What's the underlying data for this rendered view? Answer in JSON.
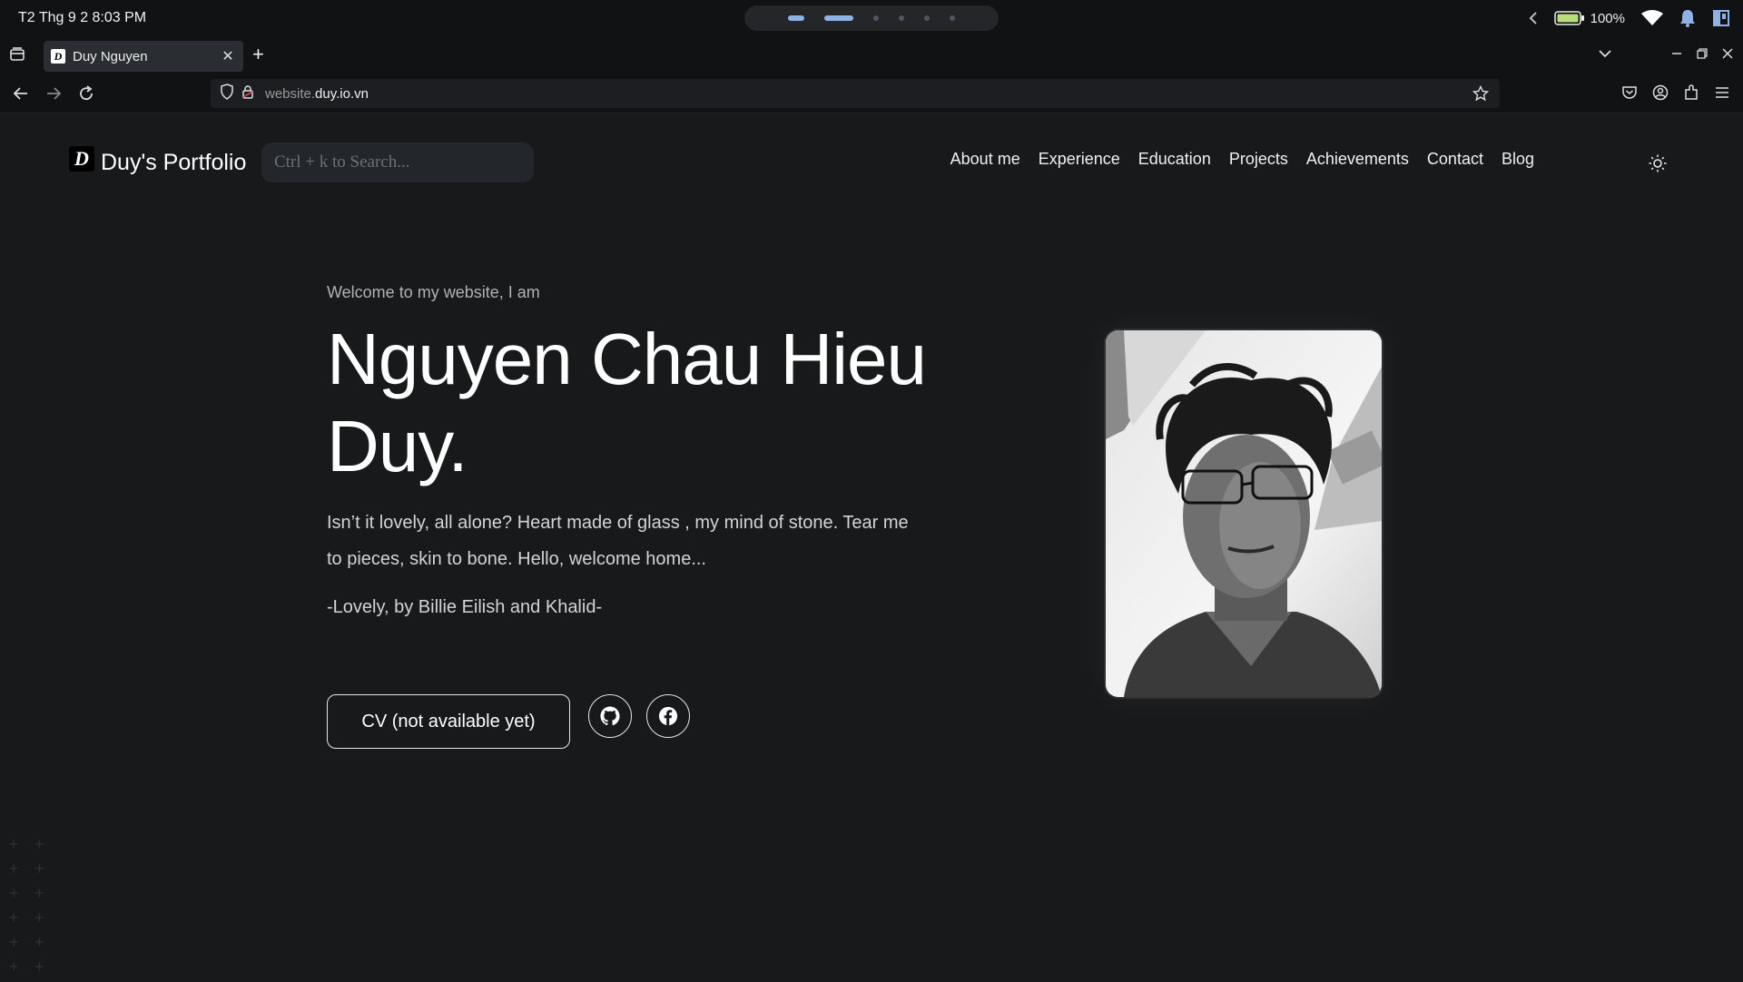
{
  "os": {
    "clock": "T2 Thg 9   2   8:03 PM",
    "battery": "100%"
  },
  "browser": {
    "tab_title": "Duy Nguyen",
    "tab_close": "✕",
    "new_tab": "+",
    "url_dim": "website.",
    "url_main": "duy.io.vn"
  },
  "site": {
    "logo_letter": "D",
    "logo_text": "Duy's Portfolio",
    "search_placeholder": "Ctrl + k to Search...",
    "menu": [
      "About me",
      "Experience",
      "Education",
      "Projects",
      "Achievements",
      "Contact",
      "Blog"
    ]
  },
  "hero": {
    "intro": "Welcome to my website, I am",
    "name": "Nguyen Chau Hieu Duy.",
    "lyric": "Isn’t it lovely, all alone? Heart made of glass , my mind of stone. Tear me to pieces, skin to bone. Hello, welcome home...",
    "credit": "-Lovely, by Billie Eilish and Khalid-",
    "cv_label": "CV (not available yet)"
  },
  "icons": {
    "social": [
      "github-icon",
      "facebook-icon"
    ],
    "theme": "sun-icon"
  }
}
